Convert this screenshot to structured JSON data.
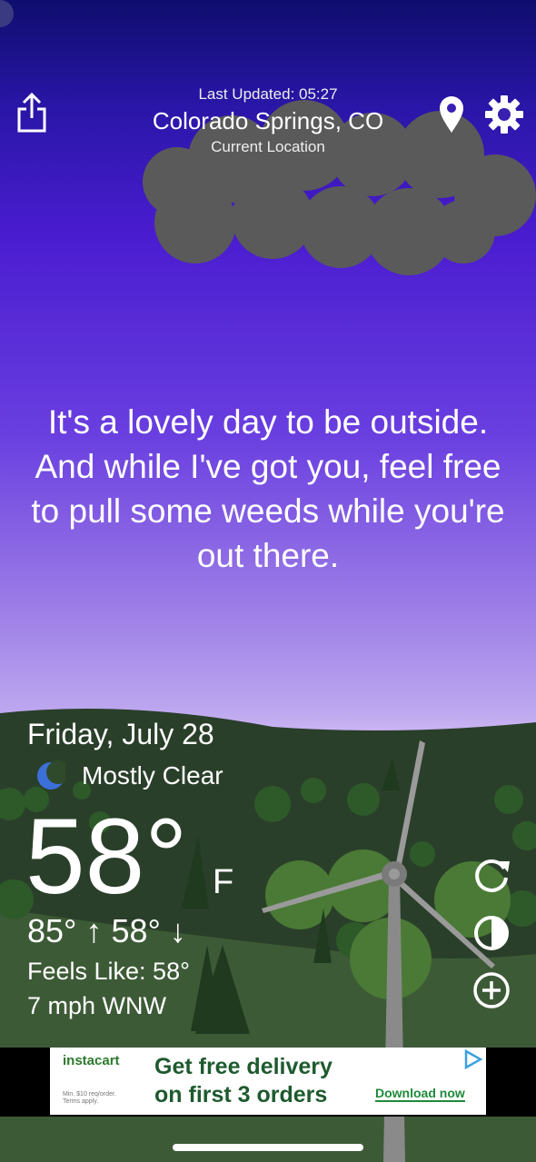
{
  "header": {
    "last_updated": "Last Updated: 05:27",
    "city": "Colorado Springs, CO",
    "location_label": "Current Location",
    "icons": [
      "share-icon",
      "location-pin-icon",
      "gear-icon"
    ]
  },
  "message": "It's a lovely day to be outside. And while I've got you, feel free to pull some weeds while you're out there.",
  "weather": {
    "date": "Friday, July 28",
    "condition": "Mostly Clear",
    "condition_icon": "moon-icon",
    "temperature": "58°",
    "unit": "F",
    "high_low": "85° ↑ 58° ↓",
    "feels_like": "Feels Like: 58°",
    "wind": "7 mph WNW"
  },
  "actions": [
    "refresh-icon",
    "theme-icon",
    "add-icon"
  ],
  "ad": {
    "brand": "instacart",
    "headline": "Get free delivery on first 3 orders",
    "cta": "Download now",
    "fine_print": "Min. $10 req/order. Terms apply."
  },
  "colors": {
    "sky_top": "#0e0d6e",
    "sky_mid": "#4a1cd0",
    "sky_bottom": "#c8b2f2",
    "ground": "#2f4a2a",
    "ad_green": "#1e5a2e"
  }
}
